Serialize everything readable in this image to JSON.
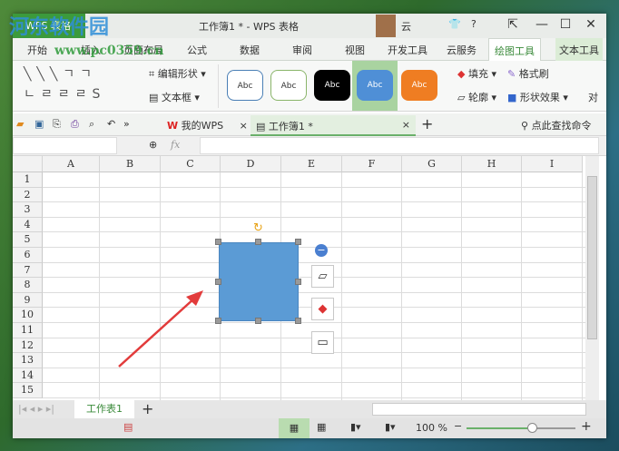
{
  "app": {
    "logo": "WPS 表格",
    "title": "工作簿1 * - WPS 表格",
    "cloud": "云"
  },
  "watermark": {
    "name": "河东软件园",
    "url": "www.pc0359.cn"
  },
  "tabs": [
    "开始",
    "插入",
    "页面布局",
    "公式",
    "数据",
    "审阅",
    "视图",
    "开发工具",
    "云服务",
    "绘图工具",
    "文本工具"
  ],
  "ribbon": {
    "edit_shape": "编辑形状",
    "text_box": "文本框",
    "styles": [
      "Abc",
      "Abc",
      "Abc",
      "Abc",
      "Abc"
    ],
    "fill": "填充",
    "format_painter": "格式刷",
    "outline": "轮廓",
    "shape_effects": "形状效果",
    "align": "对"
  },
  "quick": {
    "my_wps": "我的WPS",
    "doc_tab": "工作簿1 *",
    "search": "点此查找命令"
  },
  "formula": {
    "fx": "fx",
    "name_box": "",
    "value": ""
  },
  "columns": [
    "A",
    "B",
    "C",
    "D",
    "E",
    "F",
    "G",
    "H",
    "I"
  ],
  "rows": [
    "1",
    "2",
    "3",
    "4",
    "5",
    "6",
    "7",
    "8",
    "9",
    "10",
    "11",
    "12",
    "13",
    "14",
    "15"
  ],
  "sheet": {
    "tab": "工作表1"
  },
  "status": {
    "zoom": "100 %",
    "zoom_level": 0.6
  },
  "colors": {
    "shape": "#5b9bd5",
    "accent": "#3c9a3c",
    "arrow": "#e23b3b"
  }
}
